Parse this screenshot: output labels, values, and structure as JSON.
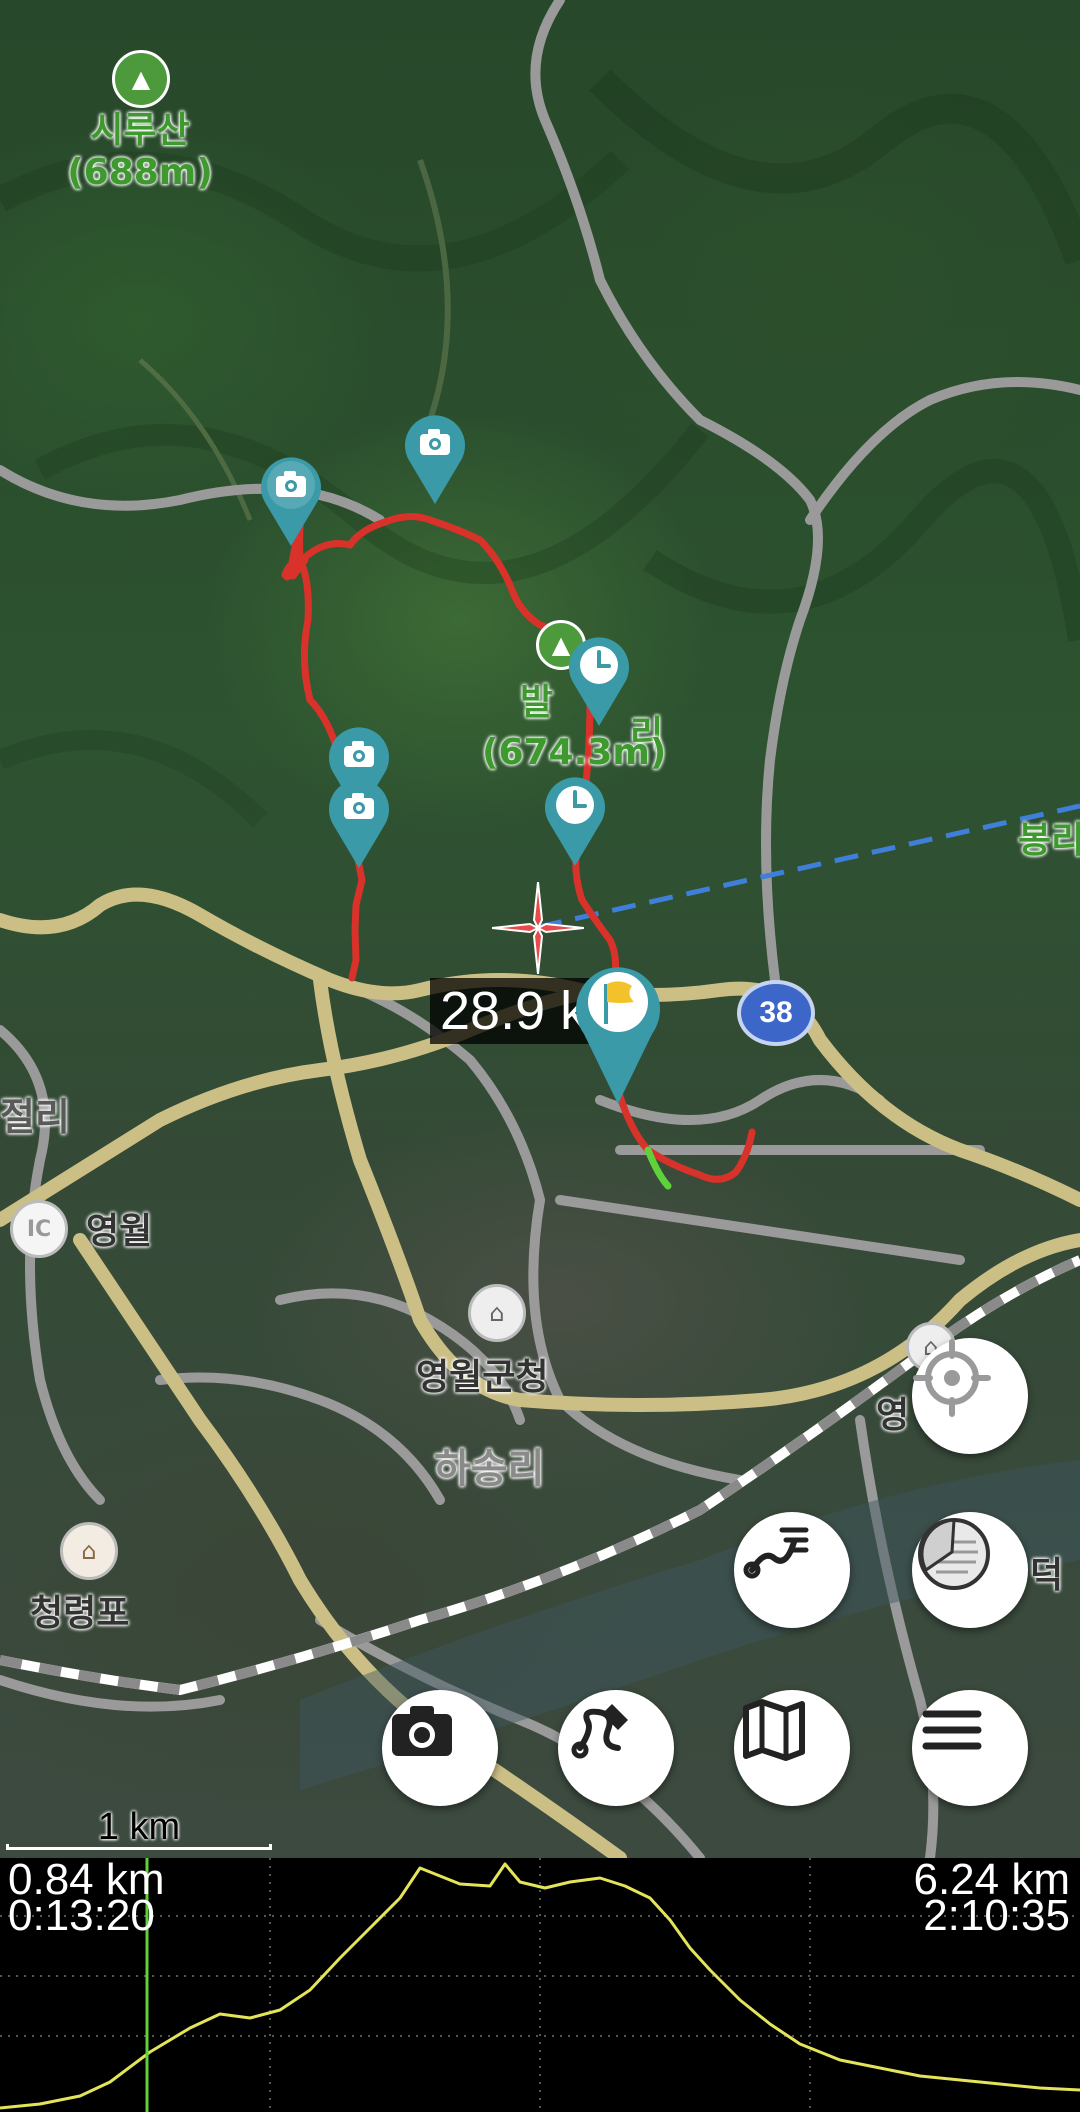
{
  "map": {
    "labels": {
      "mountain1_name": "시루산",
      "mountain1_elevation": "(688m)",
      "mountain2_name": "발",
      "mountain2_tail": "리",
      "mountain2_elevation": "(674.3m)",
      "village_right": "봉리",
      "village_left": "절리",
      "ic_name": "영월",
      "county_office": "영월군청",
      "district": "하송리",
      "cheongnyeongpo": "청령포",
      "right_cut_1": "영",
      "right_cut_2": "덕"
    },
    "ic_badge": "IC",
    "route_number": "38",
    "distance_to_target": "28.9 k",
    "scale_label": "1 km",
    "icons": {
      "mountain": "mountain-icon",
      "camera_pin": "camera-pin-icon",
      "clock_pin": "clock-pin-icon",
      "flag_pin": "flag-pin-icon",
      "crosshair": "crosshair-icon",
      "government": "government-building-icon",
      "heritage": "heritage-icon"
    },
    "colors": {
      "track": "#d8322a",
      "track_start": "#5fd13a",
      "direction_line": "#3f7fd9",
      "pin": "#3a9aa8",
      "route_sign": "#3d66c9",
      "elevation_line": "#e4e45a",
      "cursor_line": "#5fd13a"
    }
  },
  "buttons": {
    "locate": "locate-icon",
    "track_list": "track-list-icon",
    "layers": "layers-icon",
    "camera": "camera-icon",
    "draw_route": "draw-route-icon",
    "maps": "map-icon",
    "menu": "menu-icon"
  },
  "profile": {
    "left_distance": "0.84 km",
    "left_time": "0:13:20",
    "right_distance": "6.24 km",
    "right_time": "2:10:35",
    "cursor_fraction": 0.136
  }
}
